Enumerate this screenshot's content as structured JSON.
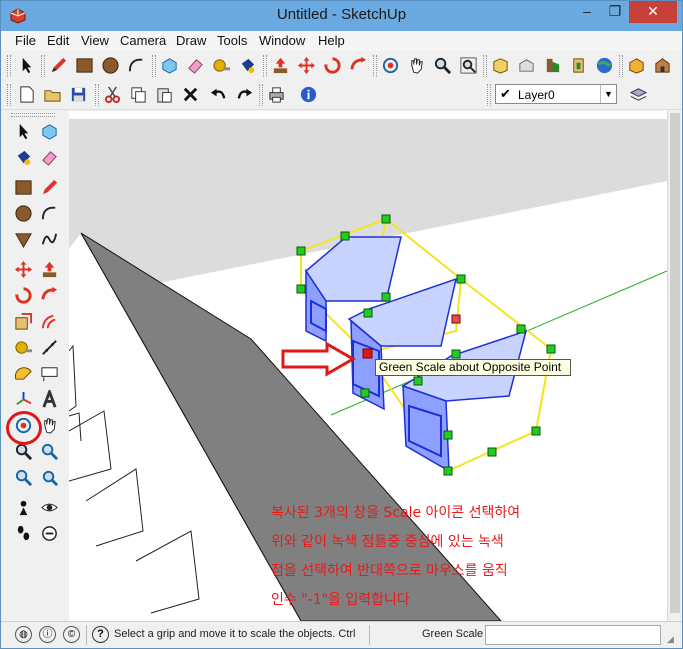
{
  "window": {
    "title": "Untitled - SketchUp",
    "controls": [
      "–",
      "❐",
      "✕"
    ]
  },
  "menu": [
    "File",
    "Edit",
    "View",
    "Camera",
    "Draw",
    "Tools",
    "Window",
    "Help"
  ],
  "toolbar_row1_icons": [
    "select-icon",
    "pencil-icon",
    "rectangle-icon",
    "circle-icon",
    "arc-icon",
    "eraser-icon",
    "paint-bucket-icon",
    "tape-measure-icon",
    "push-pull-icon",
    "move-icon",
    "rotate-icon",
    "follow-me-icon",
    "orbit-icon",
    "pan-icon",
    "zoom-icon",
    "zoom-extents-icon",
    "get-models-icon",
    "share-model-icon",
    "components-icon",
    "extension-icon",
    "google-earth-icon",
    "photo-textures-icon",
    "warehouse-icon"
  ],
  "toolbar_row2_icons": [
    "new-icon",
    "open-icon",
    "save-icon",
    "cut-icon",
    "copy-icon",
    "paste-icon",
    "delete-icon",
    "undo-icon",
    "redo-icon",
    "print-icon",
    "model-info-icon"
  ],
  "layer": {
    "checked": "✔",
    "name": "Layer0",
    "arrow": "▼"
  },
  "left_toolbar_icons": [
    "select-icon",
    "make-component-icon",
    "paint-bucket-icon",
    "eraser-icon",
    "rectangle-icon",
    "line-icon",
    "circle-icon",
    "arc-icon",
    "polygon-icon",
    "freehand-icon",
    "move-icon",
    "push-pull-icon",
    "rotate-icon",
    "follow-me-icon",
    "scale-icon",
    "offset-icon",
    "tape-measure-icon",
    "dimension-icon",
    "protractor-icon",
    "text-icon",
    "axes-icon",
    "3d-text-icon",
    "orbit-icon",
    "pan-icon",
    "zoom-icon",
    "zoom-window-icon",
    "previous-view-icon",
    "zoom-extents-icon",
    "position-camera-icon",
    "look-around-icon",
    "walk-icon",
    "section-plane-icon"
  ],
  "viewport": {
    "tooltip": "Green Scale about Opposite Point",
    "note_lines": [
      "복사된 3개의 창을 Scale 아이콘 선택하여",
      "위와 같이 녹색  점들중 중심에 있는 녹색",
      "점을 선택하여 반대쪽으로 마우스를 움직",
      "인수 \"-1\"을 입력합니다"
    ]
  },
  "status": {
    "icons": [
      "geo-location-icon",
      "credits-icon",
      "copyright-icon"
    ],
    "icon_glyphs": [
      "◍",
      "ⓘ",
      "©"
    ],
    "help_glyph": "?",
    "message": "Select a grip and move it to scale the objects. Ctrl",
    "measure_label": "Green Scale",
    "measure_value": ""
  },
  "colors": {
    "titlebar": "#6aaae0",
    "close_button": "#c7403a",
    "selection_box": "#f2e620",
    "grip": "#22cc22",
    "window_outline": "#1f2fd6",
    "annotation_red": "#e31b1b",
    "roof_gray": "#808080"
  }
}
